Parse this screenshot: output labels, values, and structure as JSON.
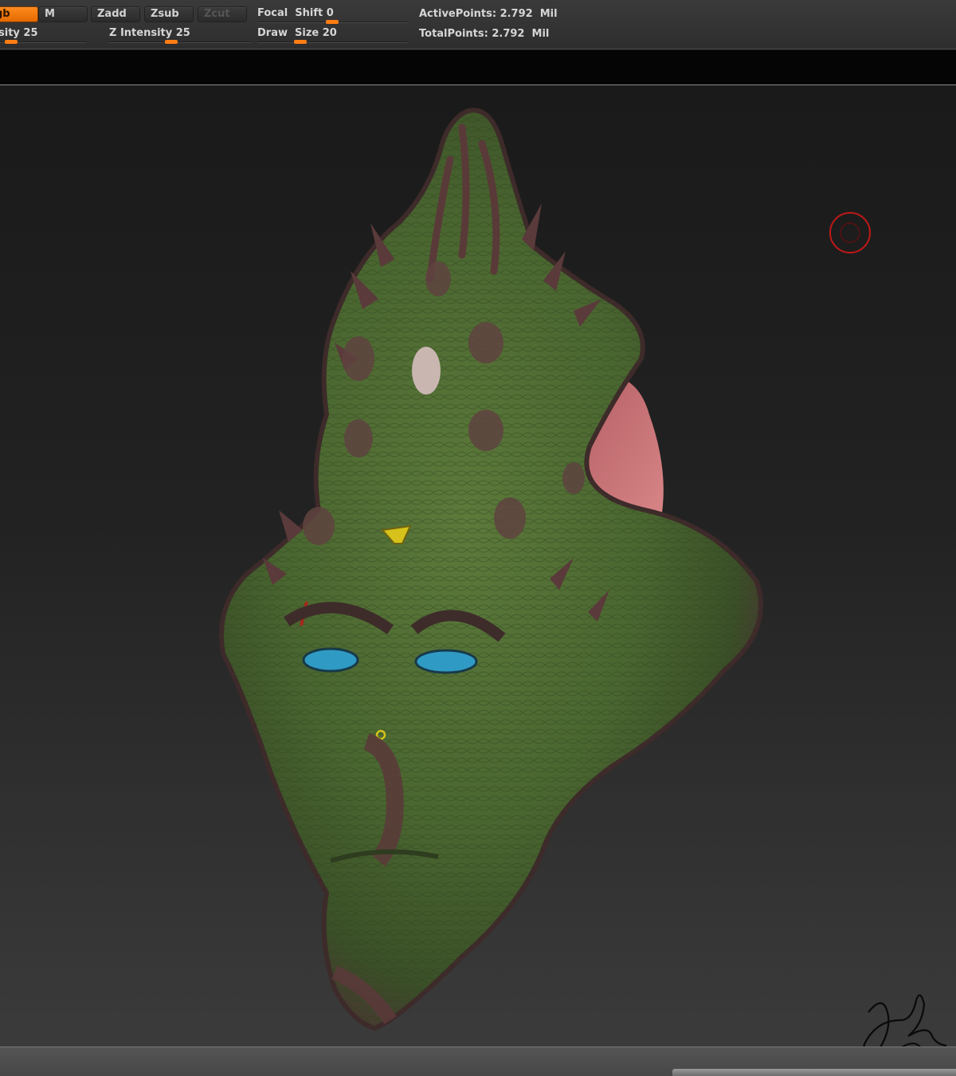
{
  "toolbar": {
    "mode_buttons": [
      {
        "label": "gb",
        "state": "active"
      },
      {
        "label": "M",
        "state": "normal"
      },
      {
        "label": "Zadd",
        "state": "normal"
      },
      {
        "label": "Zsub",
        "state": "normal"
      },
      {
        "label": "Zcut",
        "state": "disabled"
      }
    ],
    "rgb_intensity": {
      "label": "sity 25",
      "value": 25
    },
    "z_intensity": {
      "label": "Z Intensity 25",
      "value": 25
    },
    "focal_shift": {
      "label": "Focal  Shift 0",
      "value": 0
    },
    "draw_size": {
      "label": "Draw  Size 20",
      "value": 20
    }
  },
  "stats": {
    "active_points": "ActivePoints: 2.792  Mil",
    "total_points": "TotalPoints: 2.792  Mil"
  },
  "colors": {
    "accent_orange": "#ff7d12",
    "skin_green": "#4f6b33",
    "skin_purple": "#5a3b3a",
    "eye_blue": "#2f9bc4",
    "gem_yellow": "#d6c21a",
    "fin_pink": "#c76f72",
    "cursor_red": "#c01818"
  },
  "icons": {
    "brush_cursor": "brush-cursor-icon",
    "signature": "artist-signature"
  }
}
